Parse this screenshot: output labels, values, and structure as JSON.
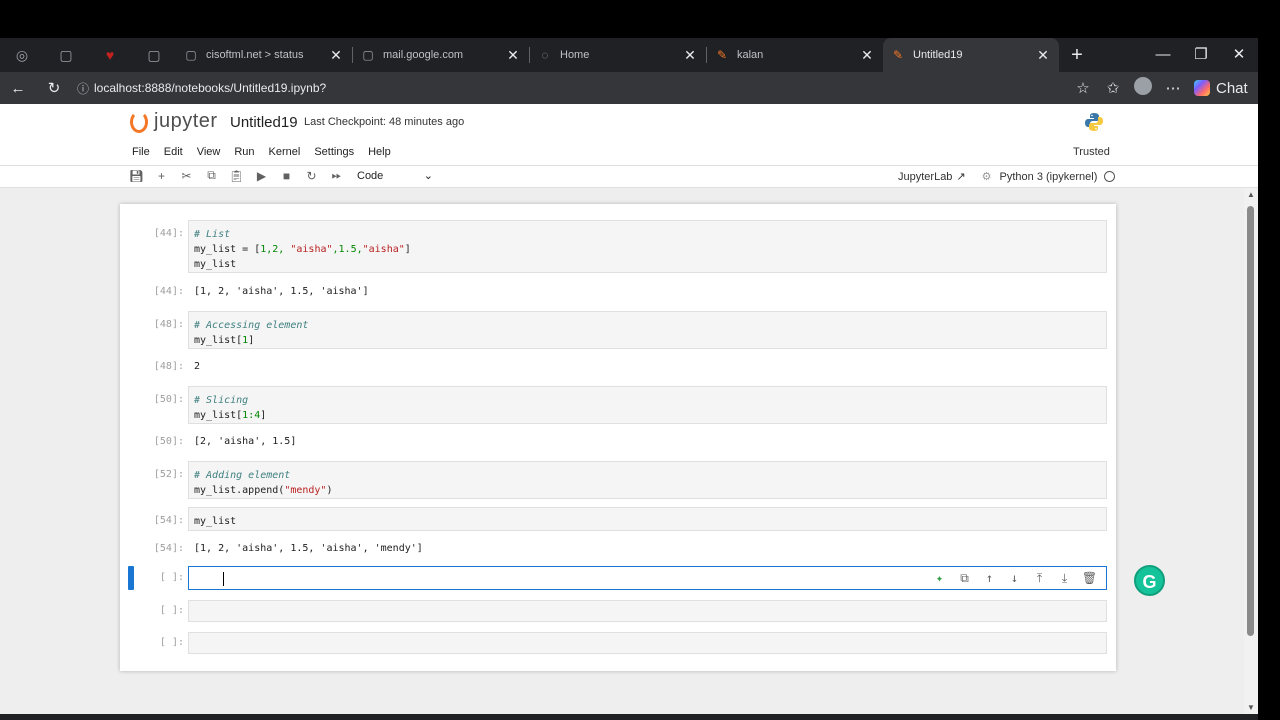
{
  "browser": {
    "tabs": [
      {
        "label": "cisoftml.net > status",
        "icon": "window-icon"
      },
      {
        "label": "mail.google.com",
        "icon": "window-icon"
      },
      {
        "label": "Home",
        "icon": "spinner-icon"
      },
      {
        "label": "kalan",
        "icon": "jupyter-favicon"
      },
      {
        "label": "Untitled19",
        "icon": "jupyter-favicon",
        "active": true
      }
    ],
    "close_glyph": "✕",
    "new_tab_glyph": "+",
    "url": "localhost:8888/notebooks/Untitled19.ipynb?",
    "chat_label": "Chat"
  },
  "jupyter": {
    "logo_text": "jupyter",
    "notebook_title": "Untitled19",
    "checkpoint": "Last Checkpoint: 48 minutes ago",
    "menu": [
      "File",
      "Edit",
      "View",
      "Run",
      "Kernel",
      "Settings",
      "Help"
    ],
    "trusted": "Trusted",
    "cell_type": "Code",
    "jupyterlab_label": "JupyterLab",
    "kernel_label": "Python 3 (ipykernel)"
  },
  "cells": {
    "c1": {
      "in_prompt": "[44]:",
      "out_prompt": "[44]:",
      "line1": "# List",
      "line2_var": "my_list",
      "line2_rest": " = [",
      "line2_nums": "1,2, ",
      "line2_str1": "\"aisha\"",
      "line2_num2": ",1.5,",
      "line2_str2": "\"aisha\"",
      "line2_end": "]",
      "line3": "my_list",
      "output": "[1, 2, 'aisha', 1.5, 'aisha']"
    },
    "c2": {
      "in_prompt": "[48]:",
      "out_prompt": "[48]:",
      "line1": "# Accessing element",
      "line2": "my_list[",
      "line2_num": "1",
      "line2_end": "]",
      "output": "2"
    },
    "c3": {
      "in_prompt": "[50]:",
      "out_prompt": "[50]:",
      "line1": "# Slicing",
      "line2": "my_list[",
      "line2_num": "1:4",
      "line2_end": "]",
      "output": "[2, 'aisha', 1.5]"
    },
    "c4": {
      "in_prompt": "[52]:",
      "line1": "# Adding element",
      "line2": "my_list.append(",
      "line2_str": "\"mendy\"",
      "line2_end": ")"
    },
    "c5": {
      "in_prompt": "[54]:",
      "out_prompt": "[54]:",
      "line1": "my_list",
      "output": "[1, 2, 'aisha', 1.5, 'aisha', 'mendy']"
    },
    "empty_prompt": "[ ]:"
  },
  "grammarly_letter": "G"
}
